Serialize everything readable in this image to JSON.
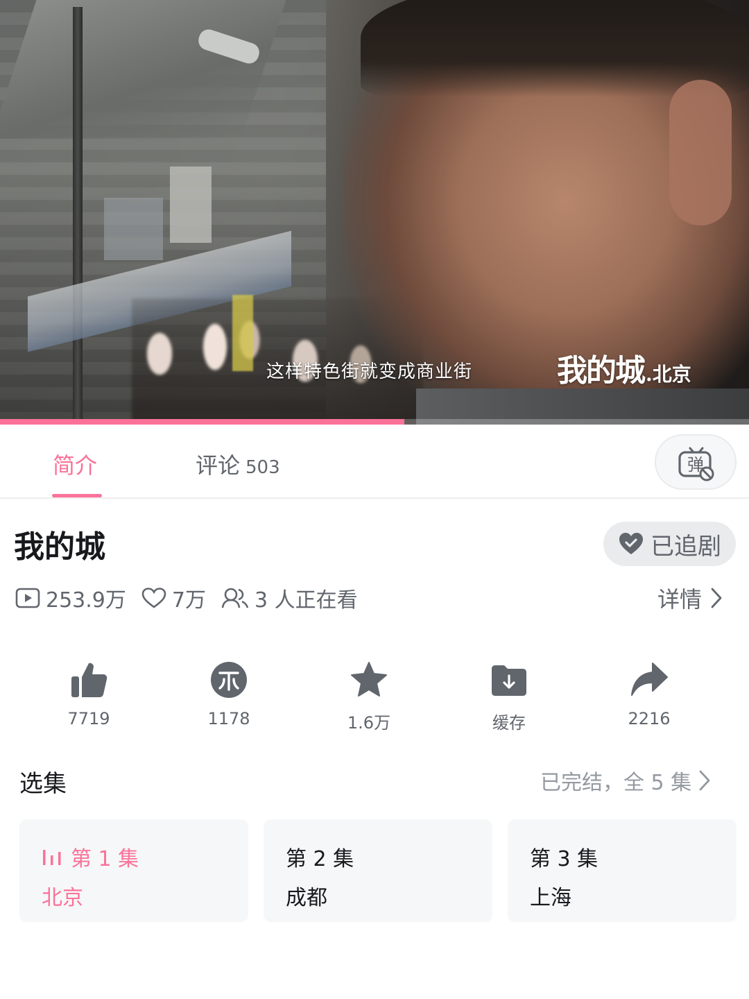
{
  "player": {
    "subtitle": "这样特色街就变成商业街",
    "watermark_title": "我的城",
    "watermark_city": ".北京",
    "progress_fraction": 0.54,
    "accent_color": "#fb7299"
  },
  "tabs": [
    {
      "label": "简介",
      "active": true
    },
    {
      "label": "评论",
      "count": "503",
      "active": false
    }
  ],
  "danmaku_button": {
    "icon": "danmaku-off-icon",
    "label": "弹"
  },
  "show": {
    "title": "我的城",
    "follow_label": "已追剧",
    "stats": {
      "plays": "253.9万",
      "likes": "7万",
      "watching": "3 人正在看"
    },
    "details_label": "详情"
  },
  "actions": [
    {
      "icon": "thumb-up-icon",
      "label": "7719"
    },
    {
      "icon": "coin-icon",
      "label": "1178"
    },
    {
      "icon": "star-icon",
      "label": "1.6万"
    },
    {
      "icon": "download-folder-icon",
      "label": "缓存"
    },
    {
      "icon": "share-icon",
      "label": "2216"
    }
  ],
  "episodes": {
    "title": "选集",
    "status": "已完结，全 5 集",
    "items": [
      {
        "number": "第 1 集",
        "name": "北京",
        "active": true
      },
      {
        "number": "第 2 集",
        "name": "成都",
        "active": false
      },
      {
        "number": "第 3 集",
        "name": "上海",
        "active": false
      }
    ]
  }
}
